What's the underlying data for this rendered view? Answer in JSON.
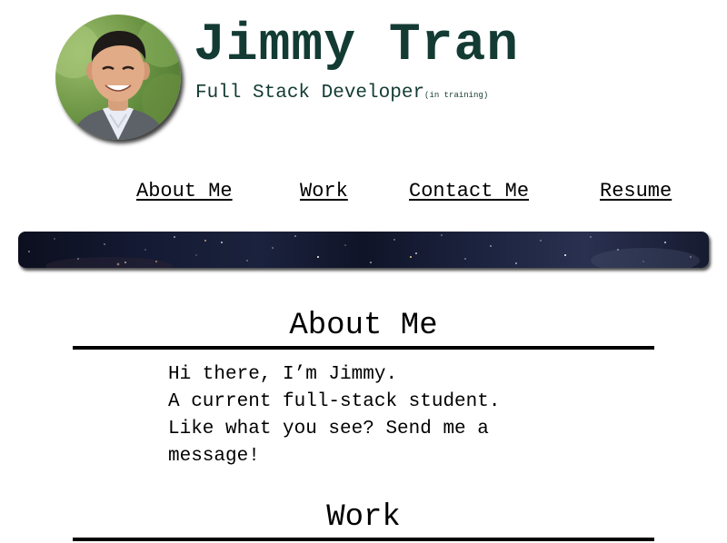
{
  "header": {
    "name": "Jimmy Tran",
    "title": "Full Stack Developer",
    "title_suffix": "(in training)",
    "avatar_icon": "profile-photo"
  },
  "nav": {
    "items": [
      {
        "label": "About Me"
      },
      {
        "label": "Work"
      },
      {
        "label": "Contact Me"
      },
      {
        "label": "Resume"
      }
    ]
  },
  "about": {
    "heading": "About Me",
    "lines": [
      "Hi there, I’m Jimmy.",
      "A current full-stack student.",
      "Like what you see? Send me a",
      "message!"
    ]
  },
  "work": {
    "heading": "Work"
  },
  "colors": {
    "name_text": "#133b33",
    "body_text": "#000000",
    "background": "#ffffff"
  }
}
